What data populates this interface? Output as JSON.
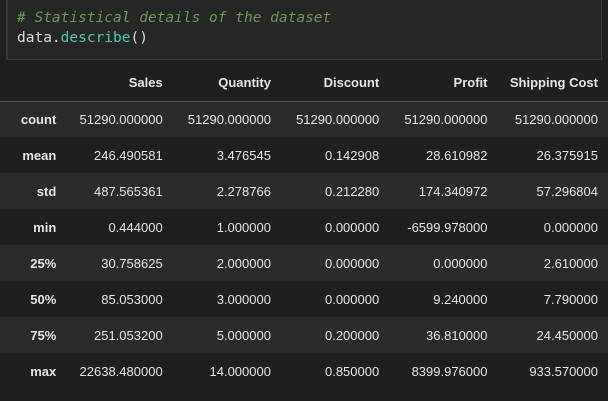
{
  "code_cell": {
    "comment": "# Statistical details of the dataset",
    "var": "data",
    "dot": ".",
    "method": "describe",
    "parens": "()"
  },
  "table": {
    "columns": [
      "Sales",
      "Quantity",
      "Discount",
      "Profit",
      "Shipping Cost"
    ],
    "rows": [
      {
        "index": "count",
        "values": [
          "51290.000000",
          "51290.000000",
          "51290.000000",
          "51290.000000",
          "51290.000000"
        ]
      },
      {
        "index": "mean",
        "values": [
          "246.490581",
          "3.476545",
          "0.142908",
          "28.610982",
          "26.375915"
        ]
      },
      {
        "index": "std",
        "values": [
          "487.565361",
          "2.278766",
          "0.212280",
          "174.340972",
          "57.296804"
        ]
      },
      {
        "index": "min",
        "values": [
          "0.444000",
          "1.000000",
          "0.000000",
          "-6599.978000",
          "0.000000"
        ]
      },
      {
        "index": "25%",
        "values": [
          "30.758625",
          "2.000000",
          "0.000000",
          "0.000000",
          "2.610000"
        ]
      },
      {
        "index": "50%",
        "values": [
          "85.053000",
          "3.000000",
          "0.000000",
          "9.240000",
          "7.790000"
        ]
      },
      {
        "index": "75%",
        "values": [
          "251.053200",
          "5.000000",
          "0.200000",
          "36.810000",
          "24.450000"
        ]
      },
      {
        "index": "max",
        "values": [
          "22638.480000",
          "14.000000",
          "0.850000",
          "8399.976000",
          "933.570000"
        ]
      }
    ]
  }
}
